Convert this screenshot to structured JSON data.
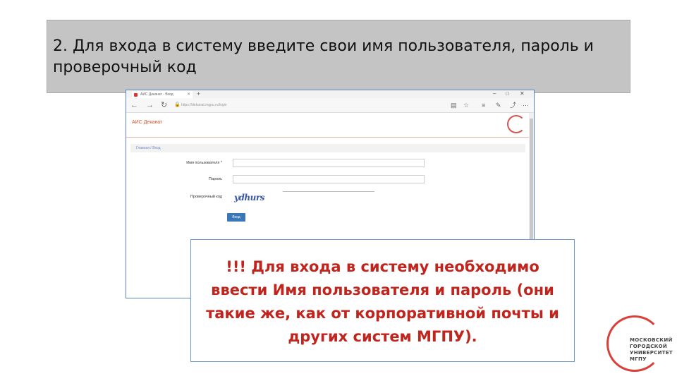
{
  "slide": {
    "header_text": "2. Для входа в систему введите свои имя пользователя, пароль и проверочный код"
  },
  "browser": {
    "tab_title": "АИС Деканат - Вход",
    "address": "https://dekanat.mgpu.ru/login",
    "app_title": "АИС Деканат",
    "breadcrumb": "Главная / Вход",
    "form": {
      "username_label": "Имя пользователя *",
      "password_label": "Пароль",
      "captcha_label": "Проверочный код",
      "captcha_value": "ydhurs",
      "submit_label": "Вход"
    }
  },
  "note": {
    "text": "!!! Для входа в систему необходимо ввести Имя пользователя и пароль (они такие же, как от корпоративной почты и других систем МГПУ)."
  },
  "logo": {
    "line1": "МОСКОВСКИЙ",
    "line2": "ГОРОДСКОЙ",
    "line3": "УНИВЕРСИТЕТ",
    "line4": "МГПУ"
  },
  "icons": {
    "back": "arrow-left-icon",
    "forward": "arrow-right-icon",
    "refresh": "refresh-icon",
    "lock": "lock-icon",
    "reader": "reader-icon",
    "favorite": "star-icon",
    "hub": "hub-icon",
    "notes": "pen-icon",
    "share": "share-icon",
    "more": "more-icon"
  },
  "colors": {
    "accent_red": "#c0241d",
    "brand_orange": "#d9532a",
    "button_blue": "#3a77b8"
  }
}
